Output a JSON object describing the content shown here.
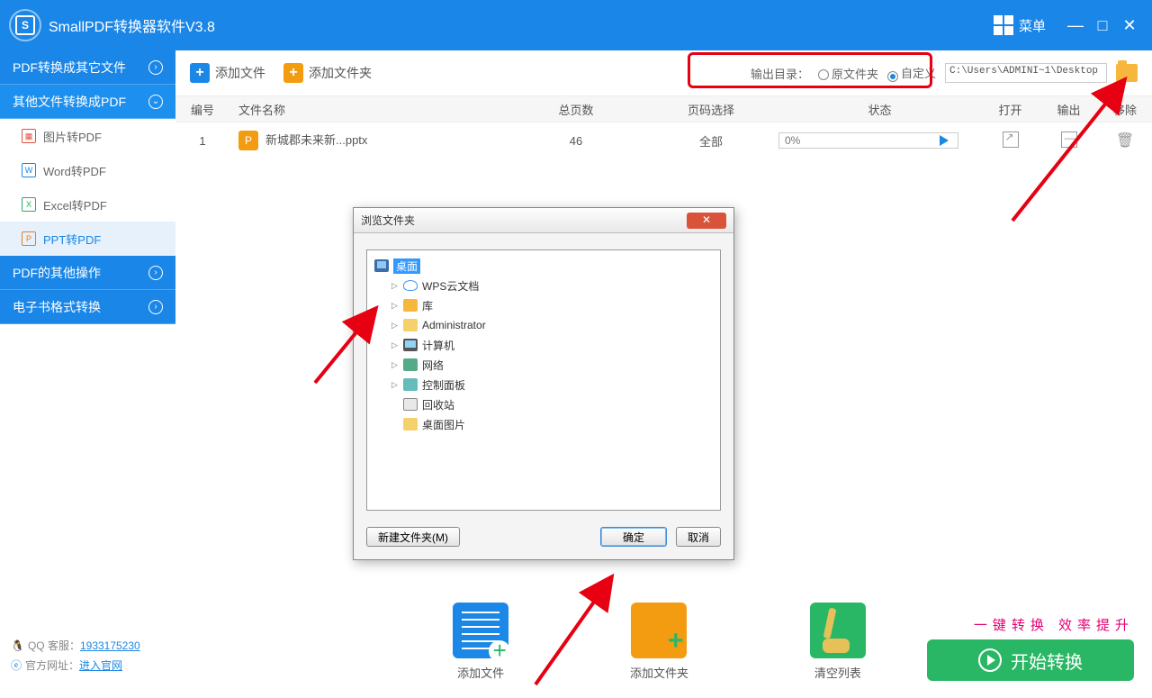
{
  "titlebar": {
    "app_title": "SmallPDF转换器软件V3.8",
    "menu_label": "菜单"
  },
  "sidebar": {
    "groups": {
      "g0": "PDF转换成其它文件",
      "g1": "其他文件转换成PDF",
      "g2": "PDF的其他操作",
      "g3": "电子书格式转换"
    },
    "items": {
      "img": "图片转PDF",
      "word": "Word转PDF",
      "excel": "Excel转PDF",
      "ppt": "PPT转PDF"
    },
    "qq_label": "QQ 客服：",
    "qq_num": "1933175230",
    "site_label": "官方网址：",
    "site_link": "进入官网"
  },
  "toolbar": {
    "add_file": "添加文件",
    "add_folder": "添加文件夹",
    "output_label": "输出目录：",
    "radio_original": "原文件夹",
    "radio_custom": "自定义",
    "path_value": "C:\\Users\\ADMINI~1\\Desktop"
  },
  "table": {
    "headers": {
      "idx": "编号",
      "name": "文件名称",
      "pages": "总页数",
      "sel": "页码选择",
      "stat": "状态",
      "open": "打开",
      "out": "输出",
      "del": "移除"
    },
    "row": {
      "idx": "1",
      "name": "新城郡未来新...pptx",
      "pages": "46",
      "sel": "全部",
      "stat": "0%"
    }
  },
  "dialog": {
    "title": "浏览文件夹",
    "nodes": {
      "desktop": "桌面",
      "wps": "WPS云文档",
      "lib": "库",
      "admin": "Administrator",
      "pc": "计算机",
      "net": "网络",
      "panel": "控制面板",
      "recycle": "回收站",
      "pics": "桌面图片"
    },
    "new_folder": "新建文件夹(M)",
    "ok": "确定",
    "cancel": "取消"
  },
  "bottom": {
    "add_file": "添加文件",
    "add_folder": "添加文件夹",
    "clear": "清空列表",
    "promo": "一键转换  效率提升",
    "start": "开始转换"
  }
}
